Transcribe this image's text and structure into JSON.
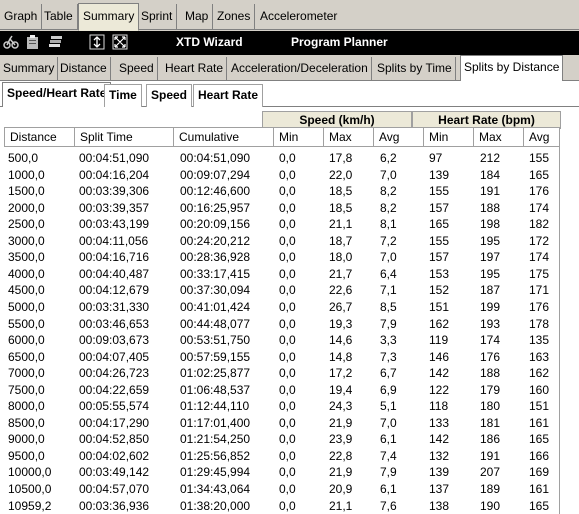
{
  "top_tabs": [
    "Graph",
    "Table",
    "Summary",
    "Sprint",
    "Map",
    "Zones",
    "Accelerometer"
  ],
  "toolbar": {
    "icons": [
      "bike-icon",
      "clipboard-icon",
      "list-icon",
      "arrows-vertical-icon",
      "fit-icon"
    ],
    "wizard_label": "XTD Wizard",
    "planner_label": "Program Planner"
  },
  "sub_tabs": [
    "Summary",
    "Distance",
    "Speed",
    "Heart Rate",
    "Acceleration/Deceleration",
    "Splits by Time",
    "Splits by Distance"
  ],
  "third_tabs": [
    "Speed/Heart Rate",
    "Time",
    "Speed",
    "Heart Rate"
  ],
  "group_headers": {
    "speed": "Speed (km/h)",
    "heart_rate": "Heart Rate (bpm)"
  },
  "columns": [
    "Distance",
    "Split Time",
    "Cumulative",
    "Min",
    "Max",
    "Avg",
    "Min",
    "Max",
    "Avg"
  ],
  "rows": [
    [
      "500,0",
      "00:04:51,090",
      "00:04:51,090",
      "0,0",
      "17,8",
      "6,2",
      "97",
      "212",
      "155"
    ],
    [
      "1000,0",
      "00:04:16,204",
      "00:09:07,294",
      "0,0",
      "22,0",
      "7,0",
      "139",
      "184",
      "165"
    ],
    [
      "1500,0",
      "00:03:39,306",
      "00:12:46,600",
      "0,0",
      "18,5",
      "8,2",
      "155",
      "191",
      "176"
    ],
    [
      "2000,0",
      "00:03:39,357",
      "00:16:25,957",
      "0,0",
      "18,5",
      "8,2",
      "157",
      "188",
      "174"
    ],
    [
      "2500,0",
      "00:03:43,199",
      "00:20:09,156",
      "0,0",
      "21,1",
      "8,1",
      "165",
      "198",
      "182"
    ],
    [
      "3000,0",
      "00:04:11,056",
      "00:24:20,212",
      "0,0",
      "18,7",
      "7,2",
      "155",
      "195",
      "172"
    ],
    [
      "3500,0",
      "00:04:16,716",
      "00:28:36,928",
      "0,0",
      "18,0",
      "7,0",
      "157",
      "197",
      "174"
    ],
    [
      "4000,0",
      "00:04:40,487",
      "00:33:17,415",
      "0,0",
      "21,7",
      "6,4",
      "153",
      "195",
      "175"
    ],
    [
      "4500,0",
      "00:04:12,679",
      "00:37:30,094",
      "0,0",
      "22,6",
      "7,1",
      "152",
      "187",
      "171"
    ],
    [
      "5000,0",
      "00:03:31,330",
      "00:41:01,424",
      "0,0",
      "26,7",
      "8,5",
      "151",
      "199",
      "176"
    ],
    [
      "5500,0",
      "00:03:46,653",
      "00:44:48,077",
      "0,0",
      "19,3",
      "7,9",
      "162",
      "193",
      "178"
    ],
    [
      "6000,0",
      "00:09:03,673",
      "00:53:51,750",
      "0,0",
      "14,6",
      "3,3",
      "119",
      "174",
      "135"
    ],
    [
      "6500,0",
      "00:04:07,405",
      "00:57:59,155",
      "0,0",
      "14,8",
      "7,3",
      "146",
      "176",
      "163"
    ],
    [
      "7000,0",
      "00:04:26,723",
      "01:02:25,877",
      "0,0",
      "17,2",
      "6,7",
      "142",
      "188",
      "162"
    ],
    [
      "7500,0",
      "00:04:22,659",
      "01:06:48,537",
      "0,0",
      "19,4",
      "6,9",
      "122",
      "179",
      "160"
    ],
    [
      "8000,0",
      "00:05:55,574",
      "01:12:44,110",
      "0,0",
      "24,3",
      "5,1",
      "118",
      "180",
      "151"
    ],
    [
      "8500,0",
      "00:04:17,290",
      "01:17:01,400",
      "0,0",
      "21,9",
      "7,0",
      "133",
      "181",
      "161"
    ],
    [
      "9000,0",
      "00:04:52,850",
      "01:21:54,250",
      "0,0",
      "23,9",
      "6,1",
      "142",
      "186",
      "165"
    ],
    [
      "9500,0",
      "00:04:02,602",
      "01:25:56,852",
      "0,0",
      "22,8",
      "7,4",
      "132",
      "191",
      "166"
    ],
    [
      "10000,0",
      "00:03:49,142",
      "01:29:45,994",
      "0,0",
      "21,9",
      "7,9",
      "139",
      "207",
      "169"
    ],
    [
      "10500,0",
      "00:04:57,070",
      "01:34:43,064",
      "0,0",
      "20,9",
      "6,1",
      "137",
      "189",
      "161"
    ],
    [
      "10959,2",
      "00:03:36,936",
      "01:38:20,000",
      "0,0",
      "21,1",
      "7,6",
      "138",
      "190",
      "165"
    ]
  ]
}
